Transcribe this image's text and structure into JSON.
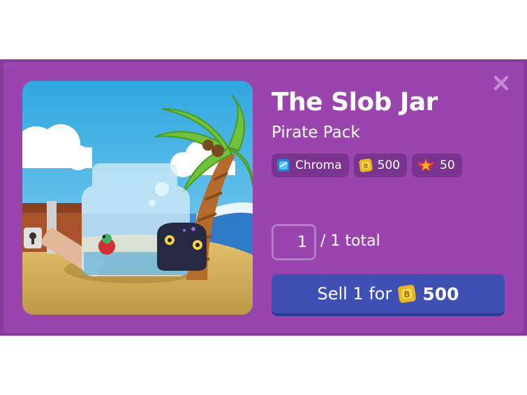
{
  "item": {
    "name": "The Slob Jar",
    "pack": "Pirate Pack"
  },
  "badges": [
    {
      "icon": "chroma-gem-icon",
      "label": "Chroma"
    },
    {
      "icon": "token-coin-icon",
      "label": "500"
    },
    {
      "icon": "star-emblem-icon",
      "label": "50"
    }
  ],
  "quantity": {
    "value": "1",
    "total_label": "/ 1 total"
  },
  "sell_button": {
    "label": "Sell 1 for",
    "price": "500",
    "icon": "token-coin-icon"
  },
  "close": {
    "icon": "close-icon"
  },
  "colors": {
    "modal_bg": "#9a45ad",
    "modal_border": "#8a3a9c",
    "badge_bg": "#7b3390",
    "sell_button_bg": "#3f50b5",
    "coin": "#e7b81f"
  }
}
